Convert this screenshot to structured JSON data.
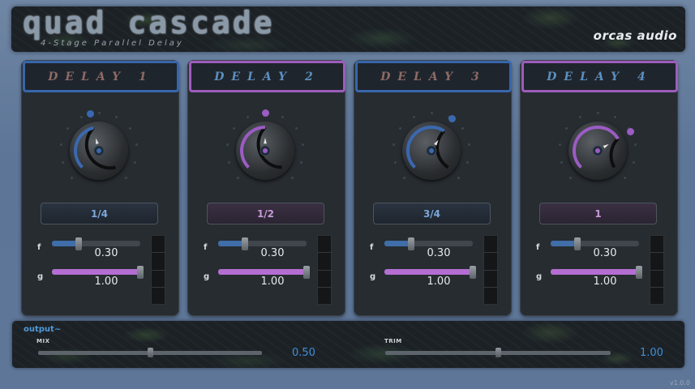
{
  "header": {
    "title": "quad cascade",
    "subtitle": "4-Stage Parallel Delay",
    "brand": "orcas audio"
  },
  "delays": [
    {
      "title": "DELAY 1",
      "division": "1/4",
      "f_label": "f",
      "f_value": "0.30",
      "f_fraction": 0.3,
      "g_label": "g",
      "g_value": "1.00",
      "g_fraction": 1.0,
      "knob_fraction": 0.45,
      "theme": "blue",
      "accent": "#3a68b0"
    },
    {
      "title": "DELAY 2",
      "division": "1/2",
      "f_label": "f",
      "f_value": "0.30",
      "f_fraction": 0.3,
      "g_label": "g",
      "g_value": "1.00",
      "g_fraction": 1.0,
      "knob_fraction": 0.5,
      "theme": "purple",
      "accent": "#9b5cc4"
    },
    {
      "title": "DELAY 3",
      "division": "3/4",
      "f_label": "f",
      "f_value": "0.30",
      "f_fraction": 0.3,
      "g_label": "g",
      "g_value": "1.00",
      "g_fraction": 1.0,
      "knob_fraction": 0.62,
      "theme": "blue",
      "accent": "#3a68b0"
    },
    {
      "title": "DELAY 4",
      "division": "1",
      "f_label": "f",
      "f_value": "0.30",
      "f_fraction": 0.3,
      "g_label": "g",
      "g_value": "1.00",
      "g_fraction": 1.0,
      "knob_fraction": 0.72,
      "theme": "purple",
      "accent": "#9b5cc4"
    }
  ],
  "output": {
    "label": "output~",
    "mix_label": "MIX",
    "mix_value": "0.50",
    "mix_fraction": 0.5,
    "trim_label": "TRIM",
    "trim_value": "1.00",
    "trim_fraction": 0.5
  },
  "version": "v1.0.0",
  "colors": {
    "blue": "#3a68b0",
    "purple": "#9b5cc4",
    "f_fill": "#3f6ea8",
    "g_fill": "#b46ed2"
  },
  "icons": {
    "meter": "level-meter-icon",
    "knob": "rotary-knob-icon"
  }
}
